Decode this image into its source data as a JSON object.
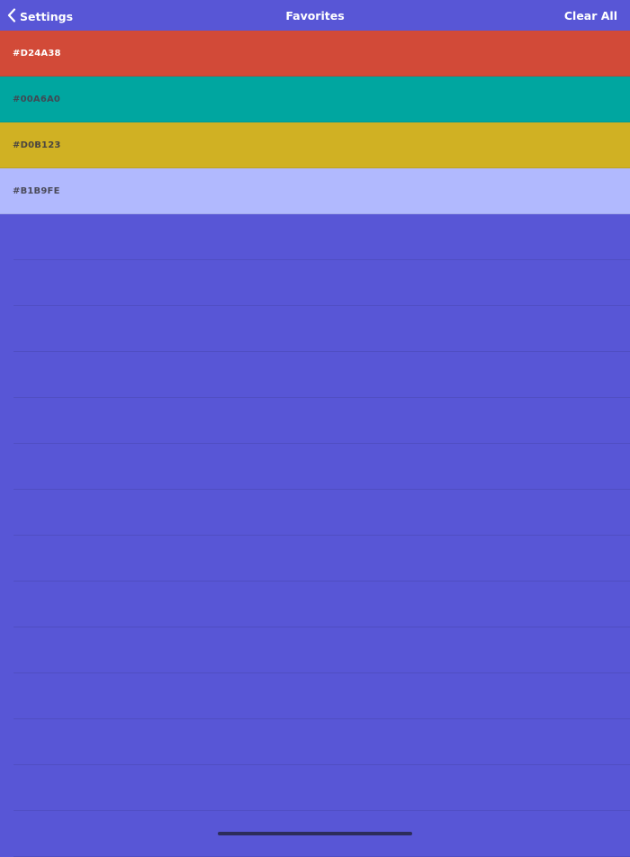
{
  "nav": {
    "back_label": "Settings",
    "title": "Favorites",
    "clear_label": "Clear All"
  },
  "favorites": [
    {
      "hex": "#D24A38",
      "color": "#D24A38",
      "text_color": "#FFFFFF"
    },
    {
      "hex": "#00A6A0",
      "color": "#00A6A0",
      "text_color": "#3F4A55"
    },
    {
      "hex": "#D0B123",
      "color": "#D0B123",
      "text_color": "#4A4540"
    },
    {
      "hex": "#B1B9FE",
      "color": "#B1B9FE",
      "text_color": "#4A4A5A"
    }
  ],
  "colors": {
    "background": "#5856D6"
  }
}
